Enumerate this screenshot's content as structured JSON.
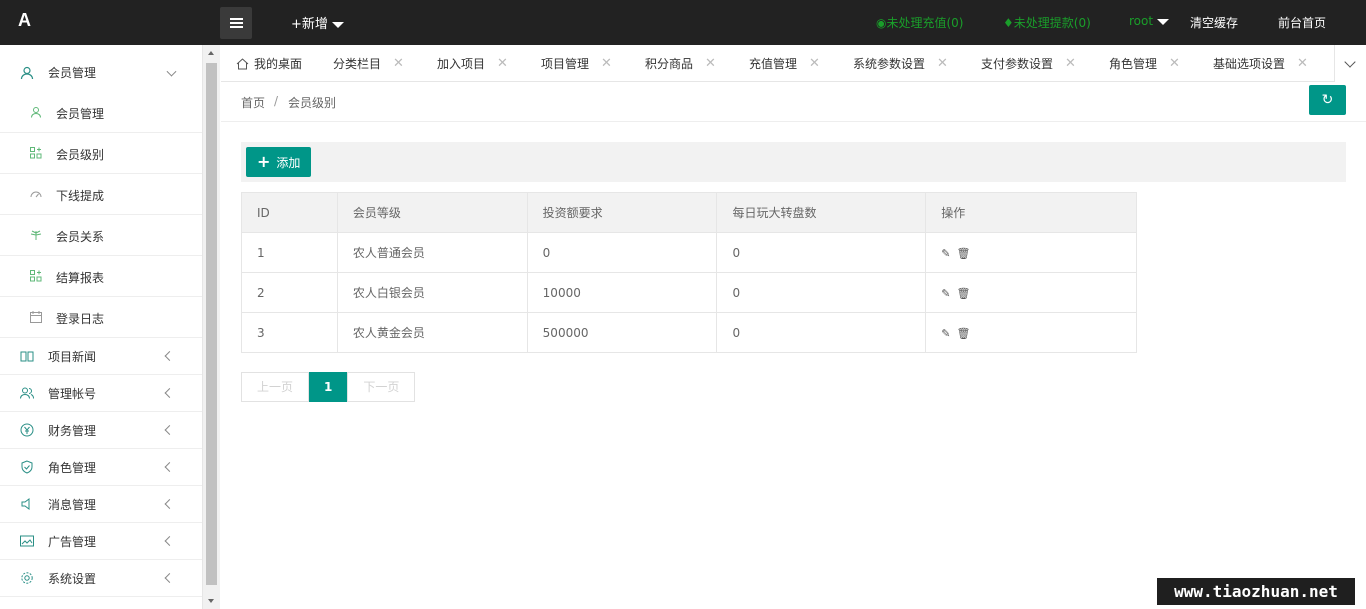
{
  "header": {
    "logo": "A",
    "new_label": "+新增",
    "pending_recharge": "未处理充值(0)",
    "pending_withdraw": "未处理提款(0)",
    "user": "root",
    "clear_cache": "清空缓存",
    "frontend_home": "前台首页"
  },
  "sidebar": {
    "group_member": "会员管理",
    "sub": [
      "会员管理",
      "会员级别",
      "下线提成",
      "会员关系",
      "结算报表",
      "登录日志"
    ],
    "groups": [
      "项目新闻",
      "管理帐号",
      "财务管理",
      "角色管理",
      "消息管理",
      "广告管理",
      "系统设置"
    ]
  },
  "tabs": [
    "我的桌面",
    "分类栏目",
    "加入项目",
    "项目管理",
    "积分商品",
    "充值管理",
    "系统参数设置",
    "支付参数设置",
    "角色管理",
    "基础选项设置"
  ],
  "breadcrumb": {
    "home": "首页",
    "sep": "/",
    "current": "会员级别"
  },
  "toolbar": {
    "add_label": "添加"
  },
  "table": {
    "headers": [
      "ID",
      "会员等级",
      "投资额要求",
      "每日玩大转盘数",
      "操作"
    ],
    "rows": [
      [
        "1",
        "农人普通会员",
        "0",
        "0"
      ],
      [
        "2",
        "农人白银会员",
        "10000",
        "0"
      ],
      [
        "3",
        "农人黄金会员",
        "500000",
        "0"
      ]
    ]
  },
  "pager": {
    "prev": "上一页",
    "current": "1",
    "next": "下一页"
  },
  "watermark": "www.tiaozhuan.net",
  "colors": {
    "accent": "#009688",
    "topbar": "#222222",
    "status_green": "#1a9e2a"
  }
}
